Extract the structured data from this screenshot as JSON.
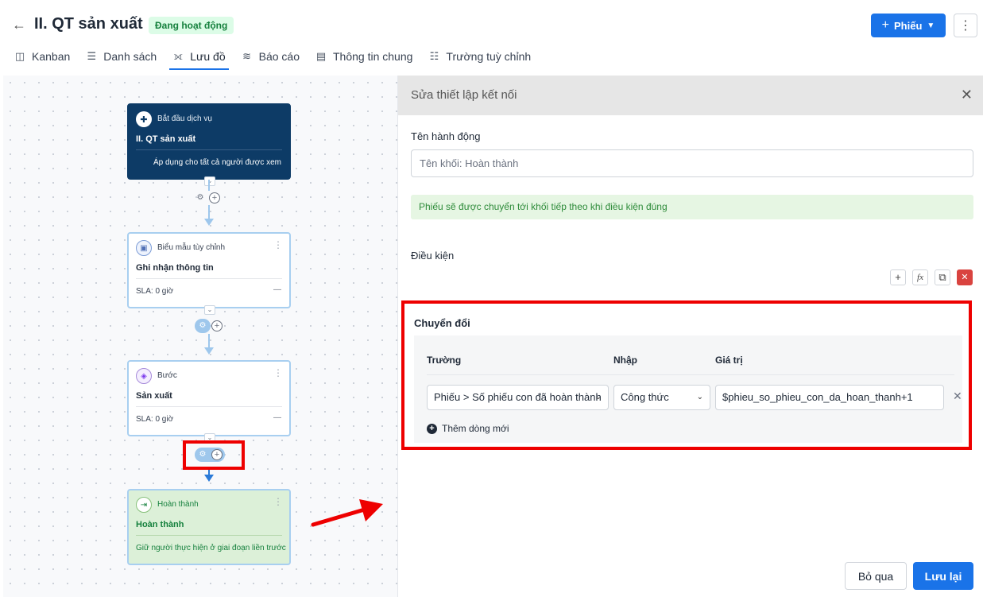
{
  "header": {
    "back_icon": "←",
    "title": "II. QT sản xuất",
    "status": "Đang hoạt động",
    "new_button": "Phiếu",
    "more_icon": "⋮"
  },
  "tabs": [
    {
      "label": "Kanban",
      "icon": "kanban-icon"
    },
    {
      "label": "Danh sách",
      "icon": "list-icon"
    },
    {
      "label": "Lưu đồ",
      "icon": "flowchart-icon"
    },
    {
      "label": "Báo cáo",
      "icon": "report-icon"
    },
    {
      "label": "Thông tin chung",
      "icon": "info-icon"
    },
    {
      "label": "Trường tuỳ chỉnh",
      "icon": "custom-fields-icon"
    }
  ],
  "active_tab": "Lưu đồ",
  "flow": {
    "start": {
      "type": "Bắt đầu dịch vụ",
      "name": "II. QT sản xuất",
      "apply": "Áp dụng cho tất cả người được xem"
    },
    "form": {
      "type": "Biểu mẫu tùy chỉnh",
      "name": "Ghi nhận thông tin",
      "sla": "SLA: 0 giờ",
      "dash": "—"
    },
    "step": {
      "type": "Bước",
      "name": "Sản xuất",
      "sla": "SLA: 0 giờ",
      "dash": "—"
    },
    "done": {
      "type": "Hoàn thành",
      "name": "Hoàn thành",
      "keep": "Giữ người thực hiện ở giai đoạn liền trước"
    }
  },
  "panel": {
    "title": "Sửa thiết lập kết nối",
    "action_label": "Tên hành động",
    "action_placeholder": "Tên khối: Hoàn thành",
    "note": "Phiếu sẽ được chuyển tới khối tiếp theo khi điều kiện đúng",
    "condition_label": "Điều kiện",
    "conversion": {
      "title": "Chuyển đổi",
      "columns": {
        "field": "Trường",
        "input": "Nhập",
        "value": "Giá trị"
      },
      "row": {
        "field": "Phiếu > Số phiếu con đã hoàn thành",
        "input": "Công thức",
        "value": "$phieu_so_phieu_con_da_hoan_thanh+1"
      },
      "add_row": "Thêm dòng mới"
    },
    "cancel": "Bỏ qua",
    "save": "Lưu lại"
  },
  "colors": {
    "primary": "#1a73e8",
    "nav_dark": "#0d3b66",
    "success_bg": "#dcf0d8",
    "highlight": "#e00000"
  }
}
